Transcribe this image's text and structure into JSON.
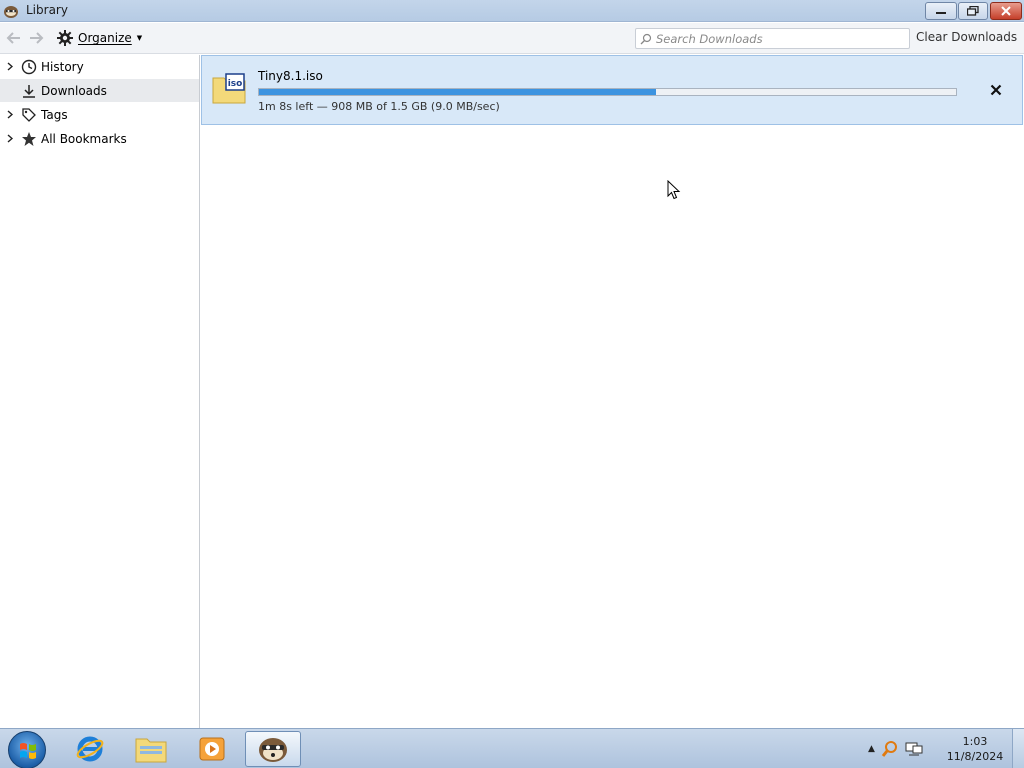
{
  "window": {
    "title": "Library",
    "icon": "firefox-raccoon-icon"
  },
  "toolbar": {
    "back_icon": "arrow-left-icon",
    "forward_icon": "arrow-right-icon",
    "organize_label": "Organize",
    "organize_icon": "gear-icon",
    "search_placeholder": "Search Downloads",
    "search_value": "",
    "clear_label": "Clear Downloads"
  },
  "sidebar": {
    "items": [
      {
        "label": "History",
        "icon": "clock-icon",
        "expandable": true,
        "selected": false
      },
      {
        "label": "Downloads",
        "icon": "download-icon",
        "expandable": false,
        "selected": true
      },
      {
        "label": "Tags",
        "icon": "tag-icon",
        "expandable": true,
        "selected": false
      },
      {
        "label": "All Bookmarks",
        "icon": "star-icon",
        "expandable": true,
        "selected": false
      }
    ]
  },
  "downloads": [
    {
      "filename": "Tiny8.1.iso",
      "file_icon": "iso-file-icon",
      "status": "1m 8s left — 908 MB of 1.5 GB (9.0 MB/sec)",
      "progress_fraction": 0.57,
      "cancel_icon": "close-icon"
    }
  ],
  "taskbar": {
    "items": [
      {
        "name": "internet-explorer-icon",
        "active": false
      },
      {
        "name": "file-explorer-icon",
        "active": false
      },
      {
        "name": "media-player-icon",
        "active": false
      },
      {
        "name": "firefox-raccoon-icon",
        "active": true
      }
    ],
    "time": "1:03",
    "date": "11/8/2024"
  },
  "colors": {
    "selection_bg": "#d8e8f8",
    "progress_fill": "#3c93e0",
    "titlebar": "#c3d5ea",
    "taskbar": "#aec3dd"
  }
}
